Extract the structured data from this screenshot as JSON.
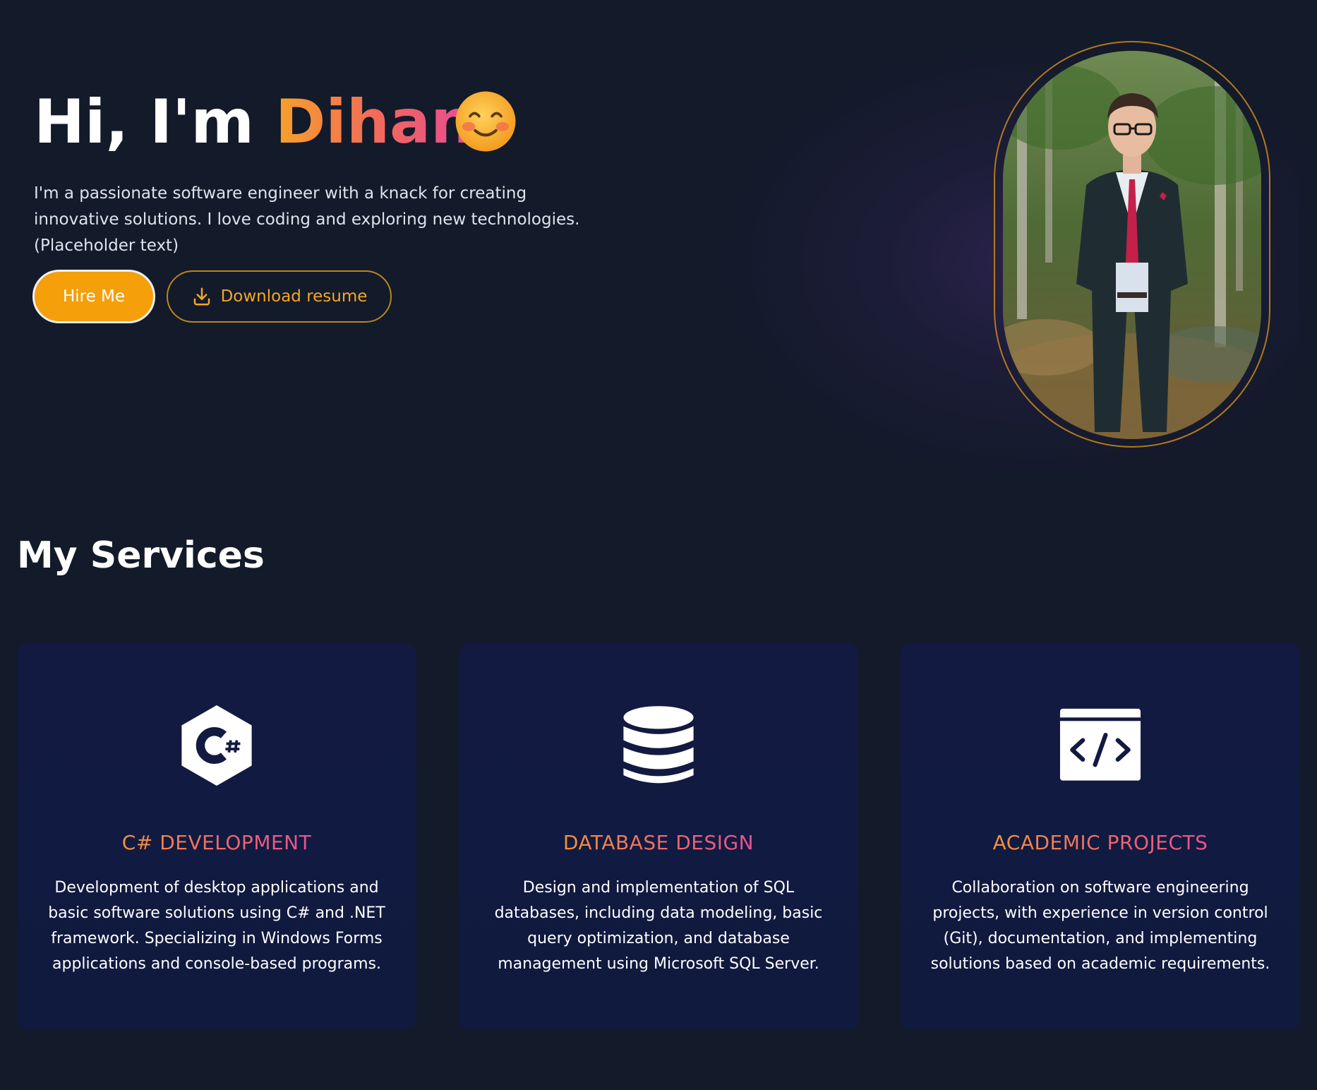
{
  "hero": {
    "greeting": "Hi, I'm ",
    "name": "Dihan",
    "emoji_icon": "smiling-face-icon",
    "description": "I'm a passionate software engineer with a knack for creating innovative solutions. I love coding and exploring new technologies. (Placeholder text)",
    "hire_label": "Hire Me",
    "resume_label": "Download resume",
    "resume_icon": "download-icon"
  },
  "services": {
    "title": "My Services",
    "items": [
      {
        "icon": "csharp-icon",
        "title": "C# DEVELOPMENT",
        "description": "Development of desktop applications and basic software solutions using C# and .NET framework. Specializing in Windows Forms applications and console-based programs."
      },
      {
        "icon": "database-icon",
        "title": "DATABASE DESIGN",
        "description": "Design and implementation of SQL databases, including data modeling, basic query optimization, and database management using Microsoft SQL Server."
      },
      {
        "icon": "code-window-icon",
        "title": "ACADEMIC PROJECTS",
        "description": "Collaboration on software engineering projects, with experience in version control (Git), documentation, and implementing solutions based on academic requirements."
      }
    ]
  },
  "colors": {
    "background": "#131a2a",
    "accent": "#f59f0b",
    "card": "#121a42",
    "gradient_start": "#f7a12a",
    "gradient_end": "#e64b95"
  }
}
